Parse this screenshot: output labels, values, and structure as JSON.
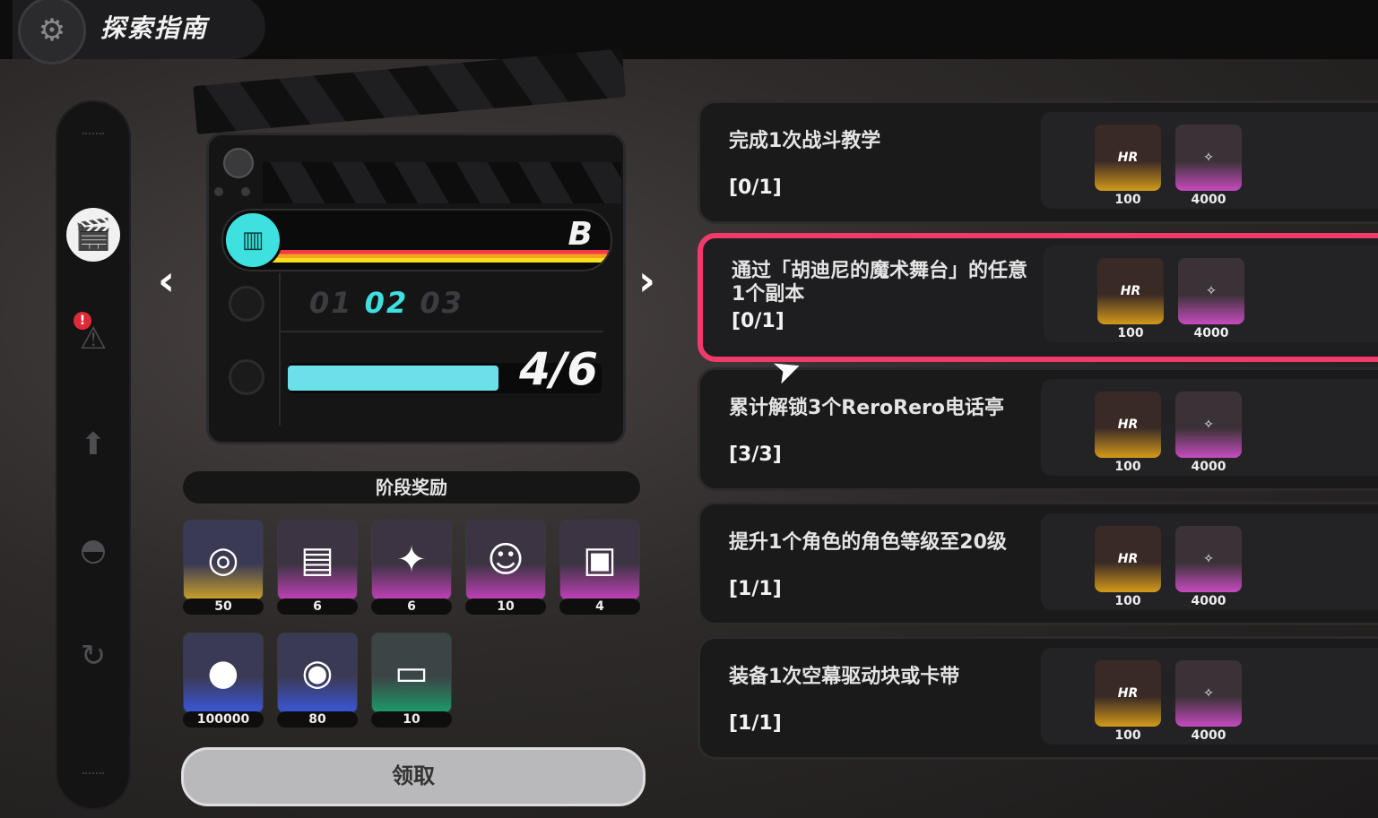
{
  "header": {
    "title": "探索指南",
    "emblem_icon": "gear-emblem-icon"
  },
  "sidebar": {
    "items": [
      {
        "icon": "clapperboard-icon",
        "active": true
      },
      {
        "icon": "exclamation-badge-icon",
        "active": false,
        "notification": "!"
      },
      {
        "icon": "arrow-up-icon",
        "active": false
      },
      {
        "icon": "disc-icon",
        "active": false
      },
      {
        "icon": "refresh-icon",
        "active": false
      }
    ]
  },
  "stage_card": {
    "grade": "B",
    "stages": [
      "01",
      "02",
      "03"
    ],
    "current_stage": "02",
    "progress_text": "4/6",
    "progress_fraction": 0.67
  },
  "stage_rewards": {
    "title": "阶段奖励",
    "items": [
      {
        "icon": "polychrome-orb-icon",
        "count": "50",
        "rarity": "gold"
      },
      {
        "icon": "card-book-icon",
        "count": "6",
        "rarity": "purple"
      },
      {
        "icon": "crystal-shard-icon",
        "count": "6",
        "rarity": "purple"
      },
      {
        "icon": "bangboo-coin-icon",
        "count": "10",
        "rarity": "purple"
      },
      {
        "icon": "cube-box-icon",
        "count": "4",
        "rarity": "purple"
      },
      {
        "icon": "denny-coin-icon",
        "count": "100000",
        "rarity": "blue"
      },
      {
        "icon": "gold-token-icon",
        "count": "80",
        "rarity": "blue"
      },
      {
        "icon": "supply-crate-icon",
        "count": "10",
        "rarity": "green"
      }
    ],
    "claim_label": "领取"
  },
  "tasks": [
    {
      "desc": "完成1次战斗教学",
      "progress": "[0/1]",
      "reward1": "100",
      "reward2": "4000",
      "active": false
    },
    {
      "desc": "通过「胡迪尼的魔术舞台」的任意1个副本",
      "progress": "[0/1]",
      "reward1": "100",
      "reward2": "4000",
      "active": true
    },
    {
      "desc": "累计解锁3个ReroRero电话亭",
      "progress": "[3/3]",
      "reward1": "100",
      "reward2": "4000",
      "active": false
    },
    {
      "desc": "提升1个角色的角色等级至20级",
      "progress": "[1/1]",
      "reward1": "100",
      "reward2": "4000",
      "active": false
    },
    {
      "desc": "装备1次空幕驱动块或卡带",
      "progress": "[1/1]",
      "reward1": "100",
      "reward2": "4000",
      "active": false
    }
  ],
  "colors": {
    "accent_pink": "#f03a6a",
    "accent_cyan": "#3ee0e0"
  }
}
